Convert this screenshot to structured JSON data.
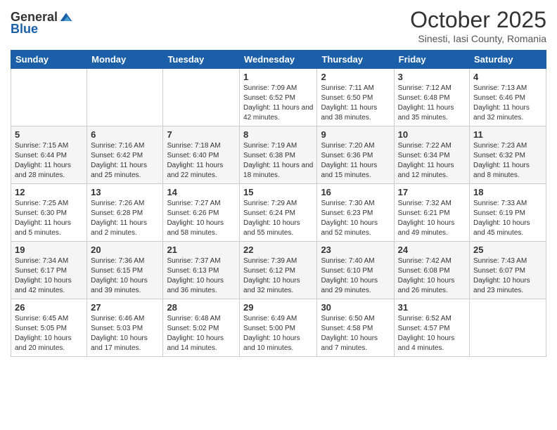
{
  "header": {
    "logo_general": "General",
    "logo_blue": "Blue",
    "month_title": "October 2025",
    "subtitle": "Sinesti, Iasi County, Romania"
  },
  "days_of_week": [
    "Sunday",
    "Monday",
    "Tuesday",
    "Wednesday",
    "Thursday",
    "Friday",
    "Saturday"
  ],
  "weeks": [
    [
      {
        "day": "",
        "info": ""
      },
      {
        "day": "",
        "info": ""
      },
      {
        "day": "",
        "info": ""
      },
      {
        "day": "1",
        "info": "Sunrise: 7:09 AM\nSunset: 6:52 PM\nDaylight: 11 hours and 42 minutes."
      },
      {
        "day": "2",
        "info": "Sunrise: 7:11 AM\nSunset: 6:50 PM\nDaylight: 11 hours and 38 minutes."
      },
      {
        "day": "3",
        "info": "Sunrise: 7:12 AM\nSunset: 6:48 PM\nDaylight: 11 hours and 35 minutes."
      },
      {
        "day": "4",
        "info": "Sunrise: 7:13 AM\nSunset: 6:46 PM\nDaylight: 11 hours and 32 minutes."
      }
    ],
    [
      {
        "day": "5",
        "info": "Sunrise: 7:15 AM\nSunset: 6:44 PM\nDaylight: 11 hours and 28 minutes."
      },
      {
        "day": "6",
        "info": "Sunrise: 7:16 AM\nSunset: 6:42 PM\nDaylight: 11 hours and 25 minutes."
      },
      {
        "day": "7",
        "info": "Sunrise: 7:18 AM\nSunset: 6:40 PM\nDaylight: 11 hours and 22 minutes."
      },
      {
        "day": "8",
        "info": "Sunrise: 7:19 AM\nSunset: 6:38 PM\nDaylight: 11 hours and 18 minutes."
      },
      {
        "day": "9",
        "info": "Sunrise: 7:20 AM\nSunset: 6:36 PM\nDaylight: 11 hours and 15 minutes."
      },
      {
        "day": "10",
        "info": "Sunrise: 7:22 AM\nSunset: 6:34 PM\nDaylight: 11 hours and 12 minutes."
      },
      {
        "day": "11",
        "info": "Sunrise: 7:23 AM\nSunset: 6:32 PM\nDaylight: 11 hours and 8 minutes."
      }
    ],
    [
      {
        "day": "12",
        "info": "Sunrise: 7:25 AM\nSunset: 6:30 PM\nDaylight: 11 hours and 5 minutes."
      },
      {
        "day": "13",
        "info": "Sunrise: 7:26 AM\nSunset: 6:28 PM\nDaylight: 11 hours and 2 minutes."
      },
      {
        "day": "14",
        "info": "Sunrise: 7:27 AM\nSunset: 6:26 PM\nDaylight: 10 hours and 58 minutes."
      },
      {
        "day": "15",
        "info": "Sunrise: 7:29 AM\nSunset: 6:24 PM\nDaylight: 10 hours and 55 minutes."
      },
      {
        "day": "16",
        "info": "Sunrise: 7:30 AM\nSunset: 6:23 PM\nDaylight: 10 hours and 52 minutes."
      },
      {
        "day": "17",
        "info": "Sunrise: 7:32 AM\nSunset: 6:21 PM\nDaylight: 10 hours and 49 minutes."
      },
      {
        "day": "18",
        "info": "Sunrise: 7:33 AM\nSunset: 6:19 PM\nDaylight: 10 hours and 45 minutes."
      }
    ],
    [
      {
        "day": "19",
        "info": "Sunrise: 7:34 AM\nSunset: 6:17 PM\nDaylight: 10 hours and 42 minutes."
      },
      {
        "day": "20",
        "info": "Sunrise: 7:36 AM\nSunset: 6:15 PM\nDaylight: 10 hours and 39 minutes."
      },
      {
        "day": "21",
        "info": "Sunrise: 7:37 AM\nSunset: 6:13 PM\nDaylight: 10 hours and 36 minutes."
      },
      {
        "day": "22",
        "info": "Sunrise: 7:39 AM\nSunset: 6:12 PM\nDaylight: 10 hours and 32 minutes."
      },
      {
        "day": "23",
        "info": "Sunrise: 7:40 AM\nSunset: 6:10 PM\nDaylight: 10 hours and 29 minutes."
      },
      {
        "day": "24",
        "info": "Sunrise: 7:42 AM\nSunset: 6:08 PM\nDaylight: 10 hours and 26 minutes."
      },
      {
        "day": "25",
        "info": "Sunrise: 7:43 AM\nSunset: 6:07 PM\nDaylight: 10 hours and 23 minutes."
      }
    ],
    [
      {
        "day": "26",
        "info": "Sunrise: 6:45 AM\nSunset: 5:05 PM\nDaylight: 10 hours and 20 minutes."
      },
      {
        "day": "27",
        "info": "Sunrise: 6:46 AM\nSunset: 5:03 PM\nDaylight: 10 hours and 17 minutes."
      },
      {
        "day": "28",
        "info": "Sunrise: 6:48 AM\nSunset: 5:02 PM\nDaylight: 10 hours and 14 minutes."
      },
      {
        "day": "29",
        "info": "Sunrise: 6:49 AM\nSunset: 5:00 PM\nDaylight: 10 hours and 10 minutes."
      },
      {
        "day": "30",
        "info": "Sunrise: 6:50 AM\nSunset: 4:58 PM\nDaylight: 10 hours and 7 minutes."
      },
      {
        "day": "31",
        "info": "Sunrise: 6:52 AM\nSunset: 4:57 PM\nDaylight: 10 hours and 4 minutes."
      },
      {
        "day": "",
        "info": ""
      }
    ]
  ]
}
